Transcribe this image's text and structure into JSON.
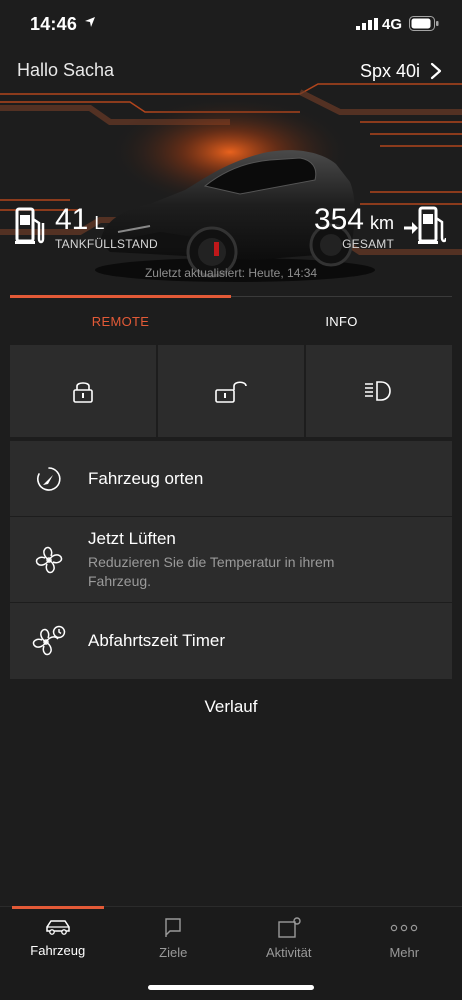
{
  "status_bar": {
    "time": "14:46",
    "network": "4G"
  },
  "header": {
    "greeting": "Hallo Sacha",
    "vehicle_name": "Spx 40i"
  },
  "stats": {
    "fuel": {
      "value": "41",
      "unit": "L",
      "label": "TANKFÜLLSTAND"
    },
    "range": {
      "value": "354",
      "unit": "km",
      "label": "GESAMT"
    }
  },
  "last_updated": "Zuletzt aktualisiert: Heute, 14:34",
  "tabs": [
    {
      "label": "REMOTE",
      "active": true
    },
    {
      "label": "INFO",
      "active": false
    }
  ],
  "quick_controls": [
    {
      "icon": "lock-icon"
    },
    {
      "icon": "unlock-icon"
    },
    {
      "icon": "headlight-icon"
    }
  ],
  "actions": [
    {
      "title": "Fahrzeug orten",
      "subtitle": "",
      "icon": "locate-icon"
    },
    {
      "title": "Jetzt Lüften",
      "subtitle": "Reduzieren Sie die Temperatur in ihrem Fahrzeug.",
      "icon": "fan-icon"
    },
    {
      "title": "Abfahrtszeit Timer",
      "subtitle": "",
      "icon": "fan-timer-icon"
    }
  ],
  "history_label": "Verlauf",
  "bottom_nav": [
    {
      "label": "Fahrzeug",
      "icon": "car-icon",
      "active": true
    },
    {
      "label": "Ziele",
      "icon": "flag-icon",
      "active": false
    },
    {
      "label": "Aktivität",
      "icon": "activity-icon",
      "active": false
    },
    {
      "label": "Mehr",
      "icon": "more-icon",
      "active": false
    }
  ],
  "colors": {
    "accent": "#e35a37",
    "background": "#1d1d1d",
    "card": "#2c2c2c"
  }
}
